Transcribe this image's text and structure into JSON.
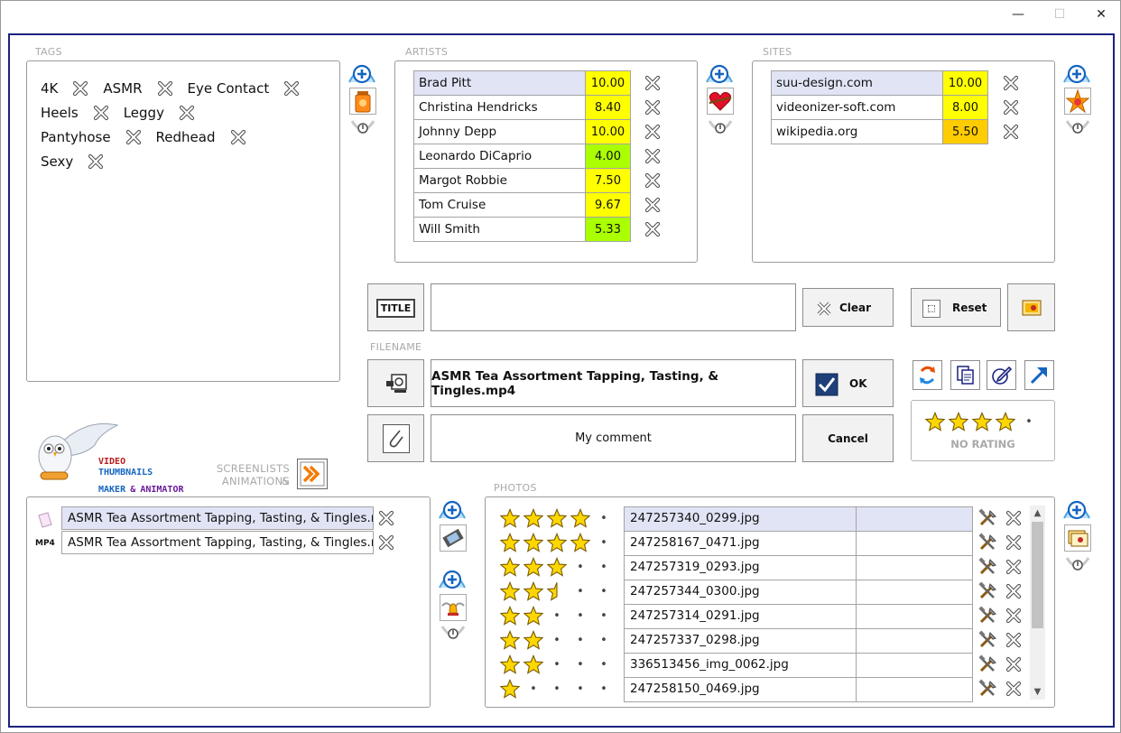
{
  "window": {
    "minimize_glyph": "—",
    "maximize_glyph": "☐",
    "close_glyph": "✕"
  },
  "labels": {
    "tags": "TAGS",
    "artists": "ARTISTS",
    "sites": "SITES",
    "filename": "FILENAME",
    "photos": "PHOTOS",
    "screenlists_line1": "SCREENLISTS &",
    "screenlists_line2": "ANIMATIONS"
  },
  "tags": [
    "4K",
    "ASMR",
    "Eye Contact",
    "Heels",
    "Leggy",
    "Pantyhose",
    "Redhead",
    "Sexy"
  ],
  "artists": [
    {
      "name": "Brad Pitt",
      "score": "10.00",
      "color": "#ffff00",
      "selected": true
    },
    {
      "name": "Christina Hendricks",
      "score": "8.40",
      "color": "#ffff00",
      "selected": false
    },
    {
      "name": "Johnny Depp",
      "score": "10.00",
      "color": "#ffff00",
      "selected": false
    },
    {
      "name": "Leonardo DiCaprio",
      "score": "4.00",
      "color": "#aaff00",
      "selected": false
    },
    {
      "name": "Margot Robbie",
      "score": "7.50",
      "color": "#ffff00",
      "selected": false
    },
    {
      "name": "Tom Cruise",
      "score": "9.67",
      "color": "#ffff00",
      "selected": false
    },
    {
      "name": "Will Smith",
      "score": "5.33",
      "color": "#aaff00",
      "selected": false
    }
  ],
  "sites": [
    {
      "name": "suu-design.com",
      "score": "10.00",
      "color": "#ffff00",
      "selected": true
    },
    {
      "name": "videonizer-soft.com",
      "score": "8.00",
      "color": "#ffff00",
      "selected": false
    },
    {
      "name": "wikipedia.org",
      "score": "5.50",
      "color": "#ffcc00",
      "selected": false
    }
  ],
  "title_section": {
    "title_icon_label": "TITLE",
    "title_value": "",
    "clear_label": "Clear",
    "reset_label": "Reset"
  },
  "filename_section": {
    "value": "ASMR Tea Assortment Tapping, Tasting, & Tingles.mp4",
    "ok_label": "OK",
    "comment_value": "My comment",
    "cancel_label": "Cancel"
  },
  "rating": {
    "stars": 4,
    "label": "NO RATING"
  },
  "logo": {
    "line1": "VIDEO",
    "line2": "THUMBNAILS",
    "line3a": "MAKER",
    "line3b": "&",
    "line3c": "ANIMATOR"
  },
  "files": [
    {
      "icon": "",
      "name": "ASMR Tea Assortment Tapping, Tasting, & Tingles.m...",
      "selected": true
    },
    {
      "icon": "MP4",
      "name": "ASMR Tea Assortment Tapping, Tasting, & Tingles.m...",
      "selected": false
    }
  ],
  "photos": [
    {
      "file": "247257340_0299.jpg",
      "stars": 4,
      "half": false,
      "selected": true
    },
    {
      "file": "247258167_0471.jpg",
      "stars": 4,
      "half": false,
      "selected": false
    },
    {
      "file": "247257319_0293.jpg",
      "stars": 3,
      "half": false,
      "selected": false
    },
    {
      "file": "247257344_0300.jpg",
      "stars": 2,
      "half": true,
      "selected": false
    },
    {
      "file": "247257314_0291.jpg",
      "stars": 2,
      "half": false,
      "selected": false
    },
    {
      "file": "247257337_0298.jpg",
      "stars": 2,
      "half": false,
      "selected": false
    },
    {
      "file": "336513456_img_0062.jpg",
      "stars": 2,
      "half": false,
      "selected": false
    },
    {
      "file": "247258150_0469.jpg",
      "stars": 1,
      "half": false,
      "selected": false
    }
  ],
  "colors": {
    "frame": "#1a237e",
    "selected_row": "#e1e4f5",
    "star": "#ffd700",
    "plus_blue": "#1565c0"
  }
}
